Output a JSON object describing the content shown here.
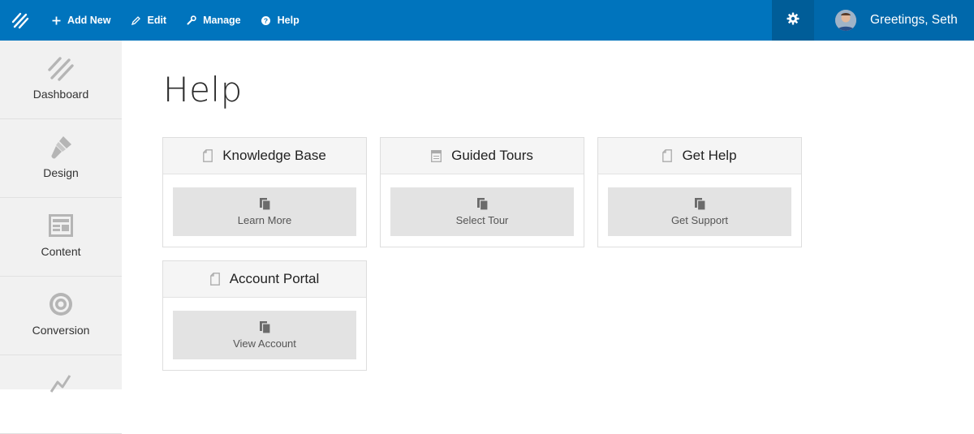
{
  "topbar": {
    "nav": [
      {
        "label": "Add New",
        "icon": "plus-icon"
      },
      {
        "label": "Edit",
        "icon": "pencil-icon"
      },
      {
        "label": "Manage",
        "icon": "wrench-icon"
      },
      {
        "label": "Help",
        "icon": "question-icon"
      }
    ],
    "settings_icon": "gear-icon",
    "greeting": "Greetings, Seth"
  },
  "sidebar": {
    "items": [
      {
        "label": "Dashboard",
        "icon": "dashboard-icon"
      },
      {
        "label": "Design",
        "icon": "brush-icon"
      },
      {
        "label": "Content",
        "icon": "content-icon"
      },
      {
        "label": "Conversion",
        "icon": "target-icon"
      },
      {
        "label": "",
        "icon": "analytics-icon"
      }
    ]
  },
  "page": {
    "title": "Help"
  },
  "cards": [
    {
      "title": "Knowledge Base",
      "header_icon": "document-icon",
      "button": "Learn More"
    },
    {
      "title": "Guided Tours",
      "header_icon": "notepad-icon",
      "button": "Select Tour"
    },
    {
      "title": "Get Help",
      "header_icon": "document-icon",
      "button": "Get Support"
    },
    {
      "title": "Account Portal",
      "header_icon": "document-icon",
      "button": "View Account"
    }
  ],
  "colors": {
    "topbar": "#0074bd",
    "topbar_dark": "#005d98",
    "sidebar_bg": "#f1f1f1",
    "button_bg": "#e3e3e3"
  }
}
